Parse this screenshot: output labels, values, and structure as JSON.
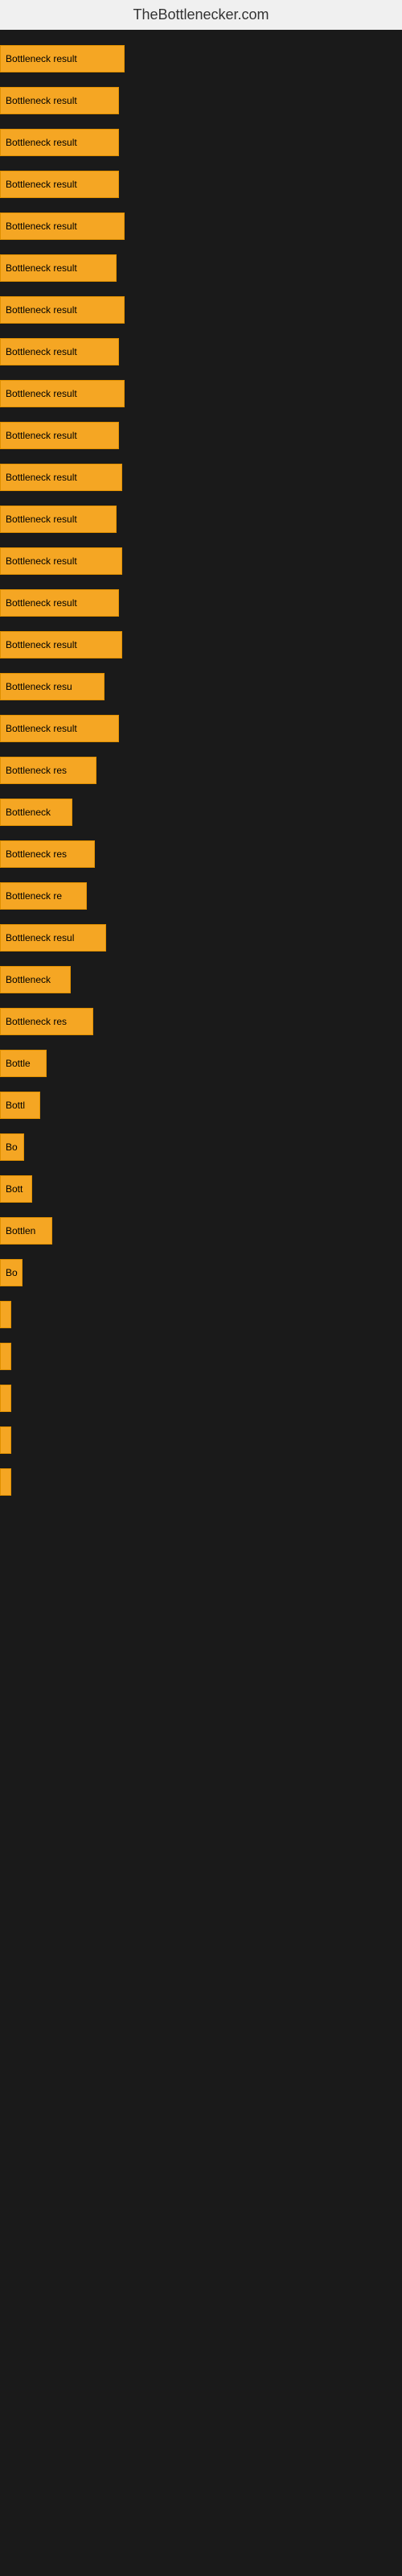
{
  "site": {
    "title": "TheBottlenecker.com"
  },
  "bars": [
    {
      "label": "Bottleneck result",
      "width": 155
    },
    {
      "label": "Bottleneck result",
      "width": 148
    },
    {
      "label": "Bottleneck result",
      "width": 148
    },
    {
      "label": "Bottleneck result",
      "width": 148
    },
    {
      "label": "Bottleneck result",
      "width": 155
    },
    {
      "label": "Bottleneck result",
      "width": 145
    },
    {
      "label": "Bottleneck result",
      "width": 155
    },
    {
      "label": "Bottleneck result",
      "width": 148
    },
    {
      "label": "Bottleneck result",
      "width": 155
    },
    {
      "label": "Bottleneck result",
      "width": 148
    },
    {
      "label": "Bottleneck result",
      "width": 152
    },
    {
      "label": "Bottleneck result",
      "width": 145
    },
    {
      "label": "Bottleneck result",
      "width": 152
    },
    {
      "label": "Bottleneck result",
      "width": 148
    },
    {
      "label": "Bottleneck result",
      "width": 152
    },
    {
      "label": "Bottleneck resu",
      "width": 130
    },
    {
      "label": "Bottleneck result",
      "width": 148
    },
    {
      "label": "Bottleneck res",
      "width": 120
    },
    {
      "label": "Bottleneck",
      "width": 90
    },
    {
      "label": "Bottleneck res",
      "width": 118
    },
    {
      "label": "Bottleneck re",
      "width": 108
    },
    {
      "label": "Bottleneck resul",
      "width": 132
    },
    {
      "label": "Bottleneck",
      "width": 88
    },
    {
      "label": "Bottleneck res",
      "width": 116
    },
    {
      "label": "Bottle",
      "width": 58
    },
    {
      "label": "Bottl",
      "width": 50
    },
    {
      "label": "Bo",
      "width": 30
    },
    {
      "label": "Bott",
      "width": 40
    },
    {
      "label": "Bottlen",
      "width": 65
    },
    {
      "label": "Bo",
      "width": 28
    },
    {
      "label": "",
      "width": 8
    },
    {
      "label": "",
      "width": 4
    },
    {
      "label": "",
      "width": 8
    },
    {
      "label": "",
      "width": 2
    },
    {
      "label": "",
      "width": 2
    }
  ]
}
